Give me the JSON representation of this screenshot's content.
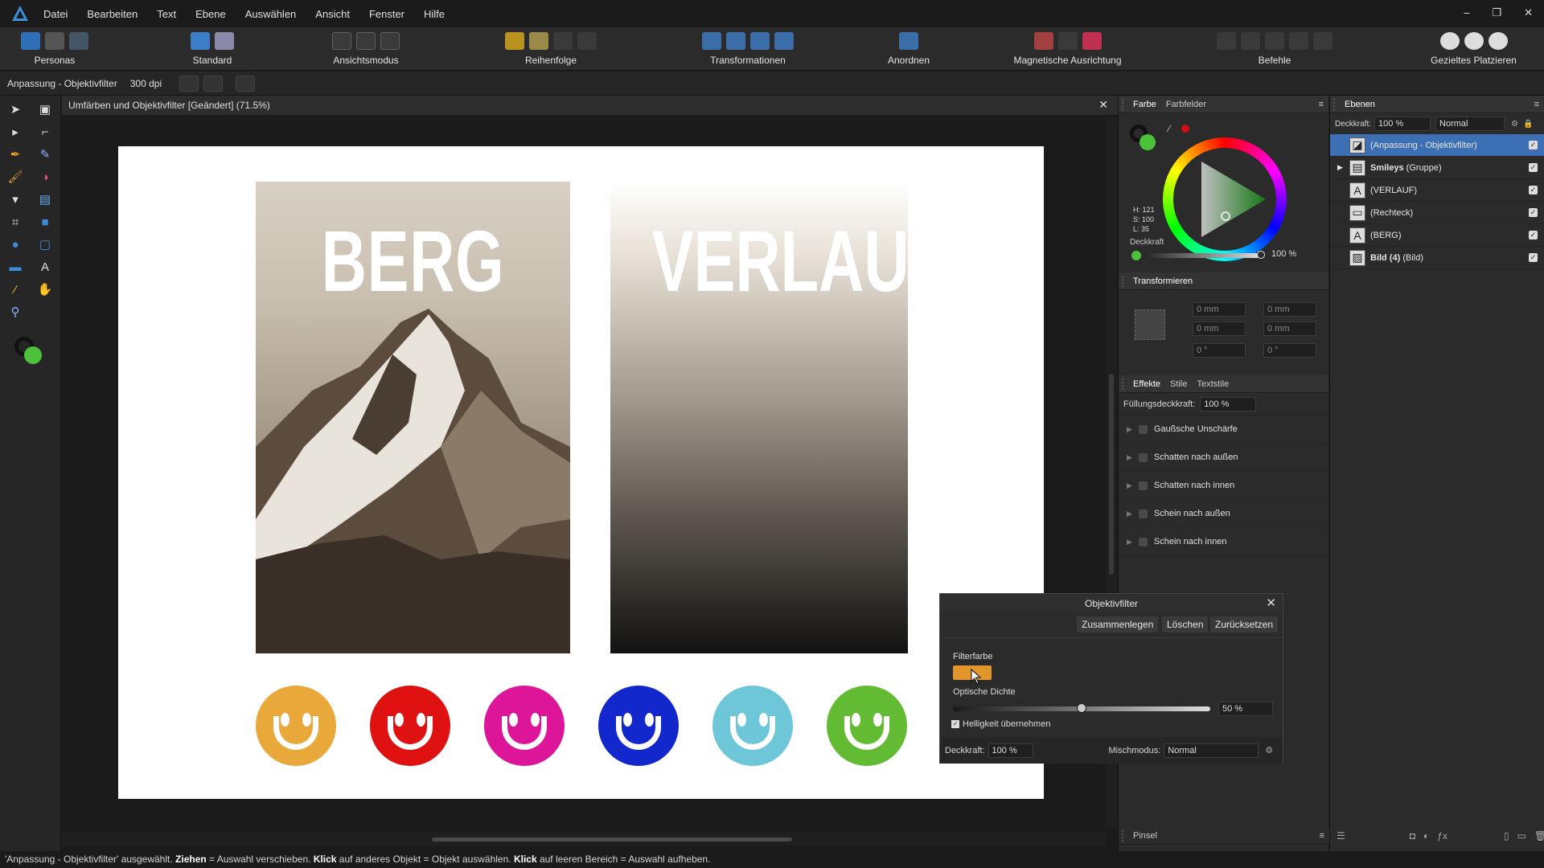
{
  "menu": {
    "items": [
      "Datei",
      "Bearbeiten",
      "Text",
      "Ebene",
      "Auswählen",
      "Ansicht",
      "Fenster",
      "Hilfe"
    ]
  },
  "window_controls": [
    "–",
    "❐",
    "✕"
  ],
  "toolbar": {
    "groups": [
      "Personas",
      "Standard",
      "Ansichtsmodus",
      "Reihenfolge",
      "Transformationen",
      "Anordnen",
      "Magnetische Ausrichtung",
      "Befehle",
      "Gezieltes Platzieren"
    ]
  },
  "context": {
    "label": "Anpassung - Objektivfilter",
    "dpi": "300 dpi"
  },
  "document": {
    "tab_title": "Umfärben und Objektivfilter [Geändert] (71.5%)"
  },
  "canvas": {
    "word1": "BERG",
    "word2": "VERLAUF",
    "smileys": [
      "#e8a93a",
      "#e01111",
      "#dd1599",
      "#1227cc",
      "#6ec7d8",
      "#63bb33"
    ]
  },
  "color_panel": {
    "tabs": [
      "Farbe",
      "Farbfelder"
    ],
    "h": "H: 121",
    "s": "S: 100",
    "l": "L: 35",
    "opacity_label": "Deckkraft",
    "opacity_value": "100 %"
  },
  "transform_panel": {
    "title": "Transformieren",
    "x": "0 mm",
    "y": "0 mm",
    "w": "0 mm",
    "h": "0 mm",
    "r": "0 °",
    "s": "0 °"
  },
  "effects_panel": {
    "tabs": [
      "Effekte",
      "Stile",
      "Textstile"
    ],
    "fill_label": "Füllungsdeckkraft:",
    "fill_value": "100 %",
    "effects": [
      "Gaußsche Unschärfe",
      "Schatten nach außen",
      "Schatten nach innen",
      "Schein nach außen",
      "Schein nach innen"
    ]
  },
  "brush_panel": {
    "title": "Pinsel"
  },
  "layers_panel": {
    "title": "Ebenen",
    "opacity_label": "Deckkraft:",
    "opacity_value": "100 %",
    "blend": "Normal",
    "layers": [
      {
        "name": "(Anpassung - Objektivfilter)",
        "bold": "",
        "selected": true
      },
      {
        "name": "(Gruppe)",
        "bold": "Smileys",
        "selected": false
      },
      {
        "name": "(VERLAUF)",
        "bold": "",
        "selected": false
      },
      {
        "name": "(Rechteck)",
        "bold": "",
        "selected": false
      },
      {
        "name": "(BERG)",
        "bold": "",
        "selected": false
      },
      {
        "name": "(Bild)",
        "bold": "Bild (4)",
        "selected": false
      }
    ]
  },
  "dialog": {
    "title": "Objektivfilter",
    "btn_merge": "Zusammenlegen",
    "btn_delete": "Löschen",
    "btn_reset": "Zurücksetzen",
    "filter_color_label": "Filterfarbe",
    "filter_color": "#e0962a",
    "density_label": "Optische Dichte",
    "density_value": "50 %",
    "density_fraction": 0.5,
    "brightness_label": "Helligkeit übernehmen",
    "opacity_label": "Deckkraft:",
    "opacity_value": "100 %",
    "blend_label": "Mischmodus:",
    "blend_value": "Normal"
  },
  "status": {
    "part1": "'Anpassung - Objektivfilter' ausgewählt. ",
    "k1": "Ziehen",
    "part2": " = Auswahl verschieben. ",
    "k2": "Klick",
    "part3": " auf anderes Objekt = Objekt auswählen. ",
    "k3": "Klick",
    "part4": " auf leeren Bereich = Auswahl aufheben."
  }
}
